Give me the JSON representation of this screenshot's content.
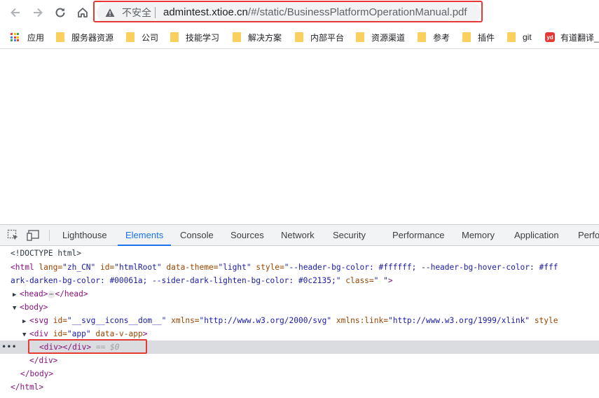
{
  "toolbar": {
    "security_label": "不安全",
    "url_host": "admintest.xtioe.cn",
    "url_path": "/#/static/BusinessPlatformOperationManual.pdf"
  },
  "bookmarks": {
    "items": [
      {
        "label": "应用",
        "icon": "apps-grid-icon"
      },
      {
        "label": "服务器资源",
        "icon": "folder-icon"
      },
      {
        "label": "公司",
        "icon": "folder-icon"
      },
      {
        "label": "技能学习",
        "icon": "folder-icon"
      },
      {
        "label": "解决方案",
        "icon": "folder-icon"
      },
      {
        "label": "内部平台",
        "icon": "folder-icon"
      },
      {
        "label": "资源渠道",
        "icon": "folder-icon"
      },
      {
        "label": "参考",
        "icon": "folder-icon"
      },
      {
        "label": "插件",
        "icon": "folder-icon"
      },
      {
        "label": "git",
        "icon": "folder-icon"
      },
      {
        "label": "有道翻译_",
        "icon": "youdao-icon"
      }
    ],
    "youdao_badge": "yd"
  },
  "devtools": {
    "tabs": [
      "Lighthouse",
      "Elements",
      "Console",
      "Sources",
      "Network",
      "Security",
      "Performance",
      "Memory",
      "Application",
      "Perfo"
    ],
    "active_tab": "Elements",
    "dom": {
      "doctype": "<!DOCTYPE html>",
      "html_open": {
        "tag": "<html",
        "lang_attr": "lang=",
        "lang_val": "\"zh_CN\"",
        "id_attr": "id=",
        "id_val": "\"htmlRoot\"",
        "theme_attr": "data-theme=",
        "theme_val": "\"light\"",
        "style_attr": "style=",
        "style_val_1": "\"--header-bg-color: #ffffff; --header-bg-hover-color: #fff",
        "style_val_2": "ark-darken-bg-color: #00061a; --sider-dark-lighten-bg-color: #0c2135;\"",
        "class_attr": "class=",
        "class_val": "\" \"",
        "close": ">"
      },
      "head": {
        "open": "<head>",
        "close": "</head>",
        "ellipsis": "⋯"
      },
      "body_open": "<body>",
      "svg": {
        "tag": "<svg",
        "id_attr": "id=",
        "id_val": "\"__svg__icons__dom__\"",
        "xmlns_attr": "xmlns=",
        "xmlns_val": "\"http://www.w3.org/2000/svg\"",
        "xlink_attr": "xmlns:link=",
        "xlink_val": "\"http://www.w3.org/1999/xlink\"",
        "style_attr": "style"
      },
      "app_div": {
        "tag": "<div",
        "id_attr": "id=",
        "id_val": "\"app\"",
        "extra_attr": "data-v-app",
        "close": ">"
      },
      "selected_node": {
        "markup": "<div></div>",
        "console_ref": "== $0",
        "gutter": "•••"
      },
      "div_close": "</div>",
      "body_close": "</body>",
      "html_close": "</html>"
    }
  },
  "colors": {
    "highlight": "#e53935",
    "active_tab": "#1a73e8",
    "folder": "#f9cf5d"
  }
}
